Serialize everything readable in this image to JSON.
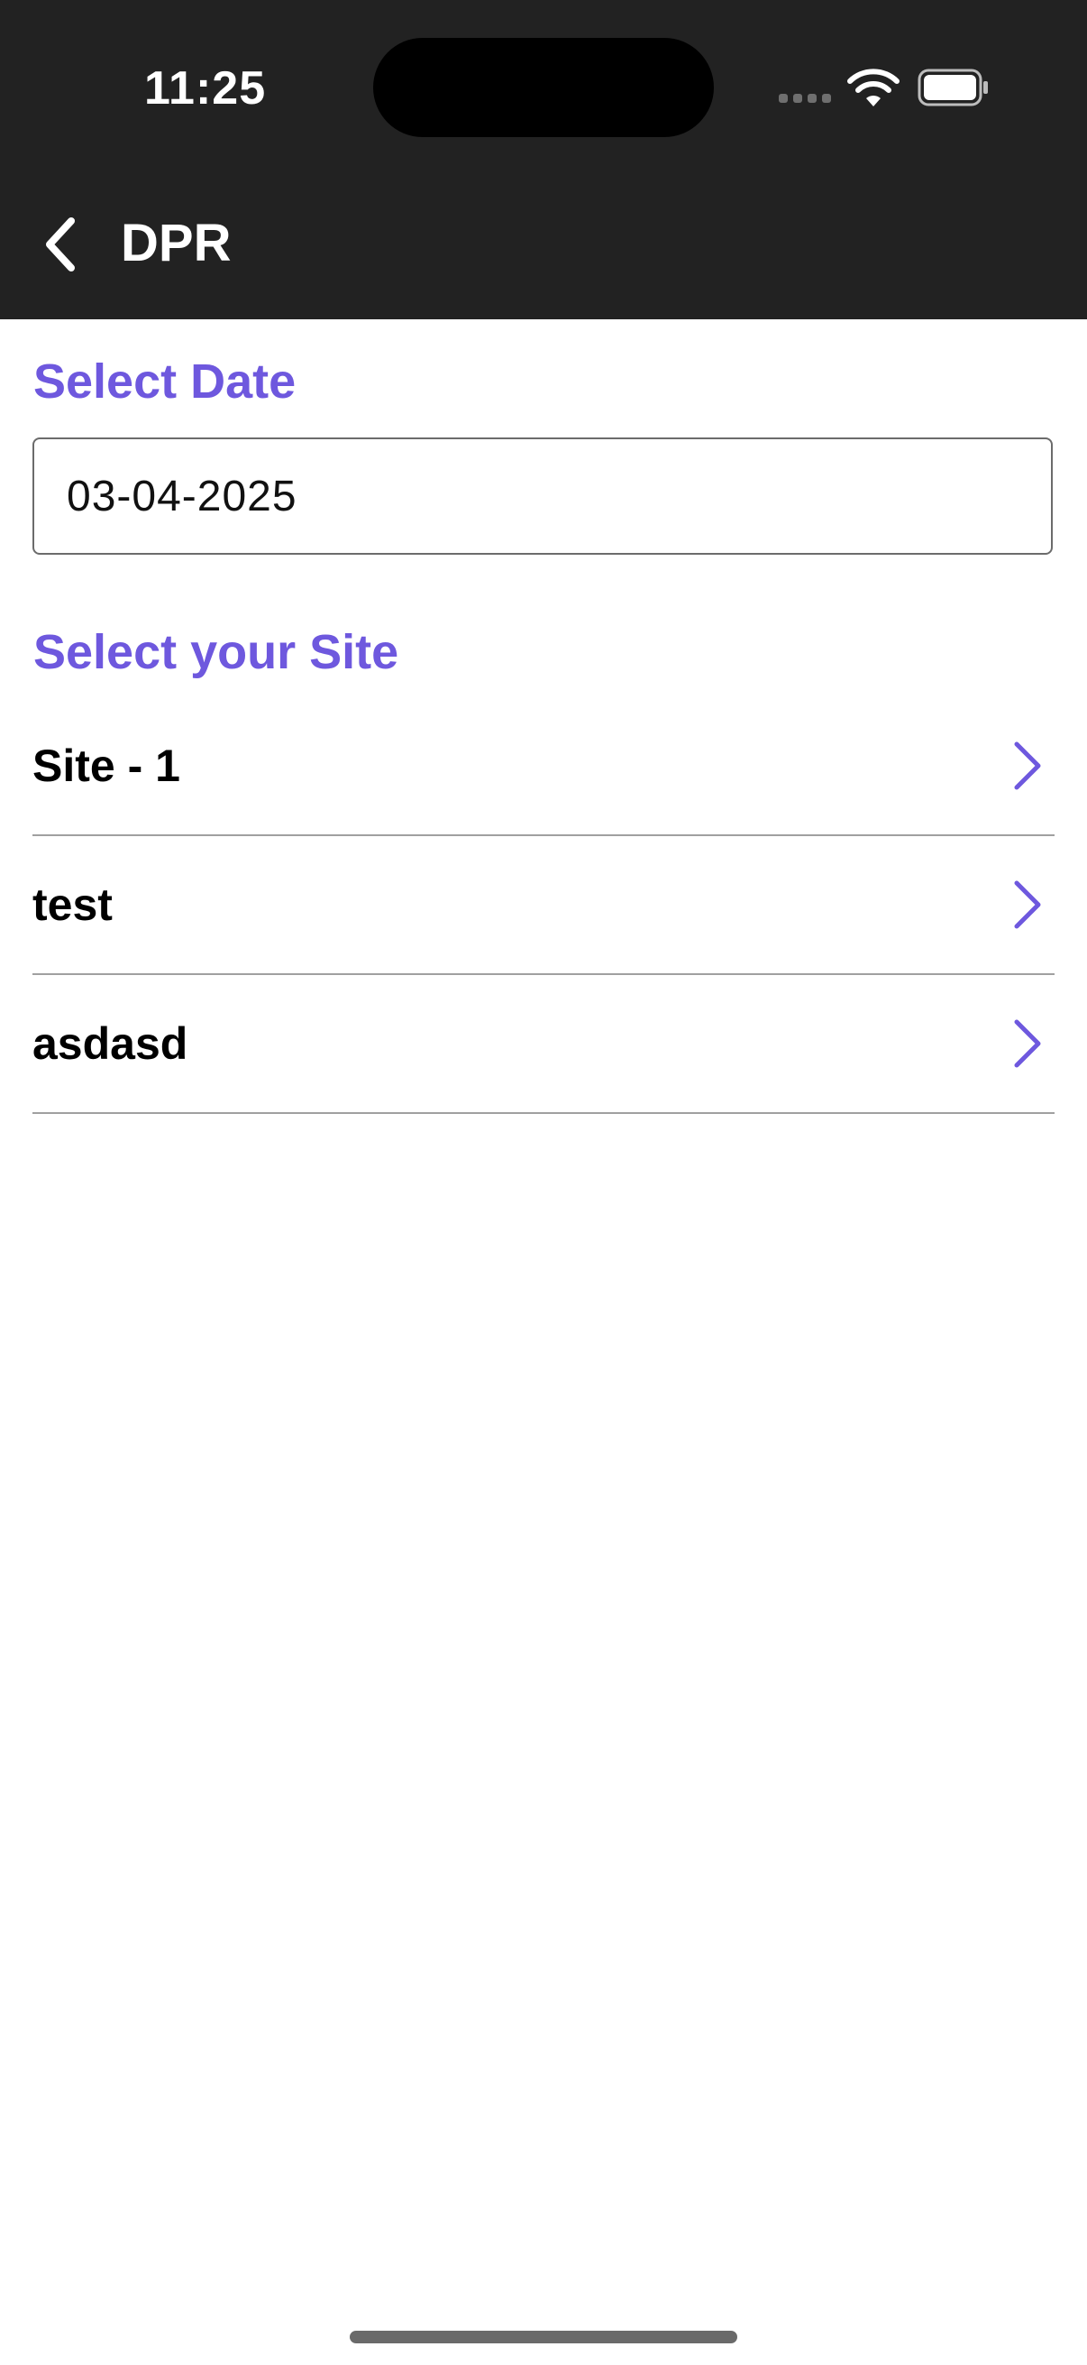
{
  "status_bar": {
    "time": "11:25",
    "icons": [
      "signal-icon",
      "wifi-icon",
      "battery-icon"
    ]
  },
  "nav": {
    "back_icon": "chevron-left-icon",
    "title": "DPR"
  },
  "date_section": {
    "label": "Select Date",
    "value": "03-04-2025"
  },
  "site_section": {
    "label": "Select your Site",
    "items": [
      {
        "name": "Site - 1"
      },
      {
        "name": "test"
      },
      {
        "name": "asdasd"
      }
    ],
    "chevron_icon": "chevron-right-icon"
  },
  "colors": {
    "accent": "#6e58de",
    "header_bg": "#222222",
    "text": "#000000",
    "divider": "#a0a0a0"
  }
}
